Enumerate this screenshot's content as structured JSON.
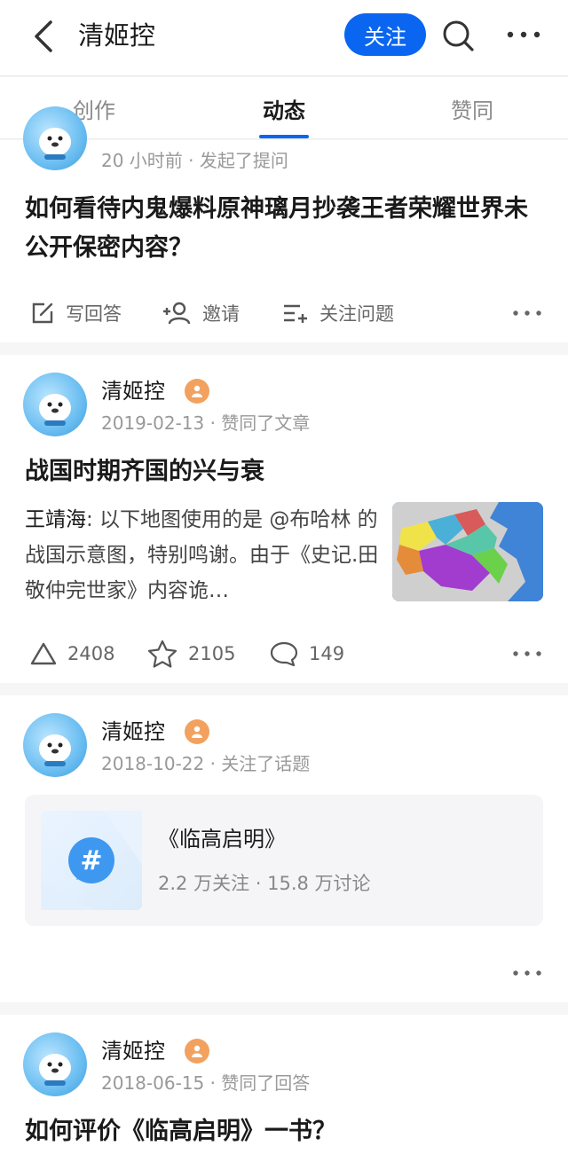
{
  "header": {
    "title": "清姬控",
    "follow_label": "关注"
  },
  "tabs": [
    {
      "label": "创作"
    },
    {
      "label": "动态"
    },
    {
      "label": "赞同"
    }
  ],
  "feed": [
    {
      "meta": "20 小时前 · 发起了提问",
      "title": "如何看待内鬼爆料原神璃月抄袭王者荣耀世界未公开保密内容？",
      "actions": {
        "answer": "写回答",
        "invite": "邀请",
        "follow_question": "关注问题"
      }
    },
    {
      "name": "清姬控",
      "meta": "2019-02-13 · 赞同了文章",
      "title": "战国时期齐国的兴与衰",
      "author": "王靖海",
      "excerpt": ": 以下地图使用的是 @布哈林 的战国示意图，特别鸣谢。由于《史记.田敬仲完世家》内容诡…",
      "stats": {
        "likes": "2408",
        "favorites": "2105",
        "comments": "149"
      }
    },
    {
      "name": "清姬控",
      "meta": "2018-10-22 · 关注了话题",
      "topic_title": "《临高启明》",
      "topic_sub": "2.2 万关注 · 15.8 万讨论"
    },
    {
      "name": "清姬控",
      "meta": "2018-06-15 · 赞同了回答",
      "title": "如何评价《临高启明》一书？"
    }
  ],
  "colors": {
    "accent": "#0a66f0",
    "badge": "#f2a15f"
  }
}
